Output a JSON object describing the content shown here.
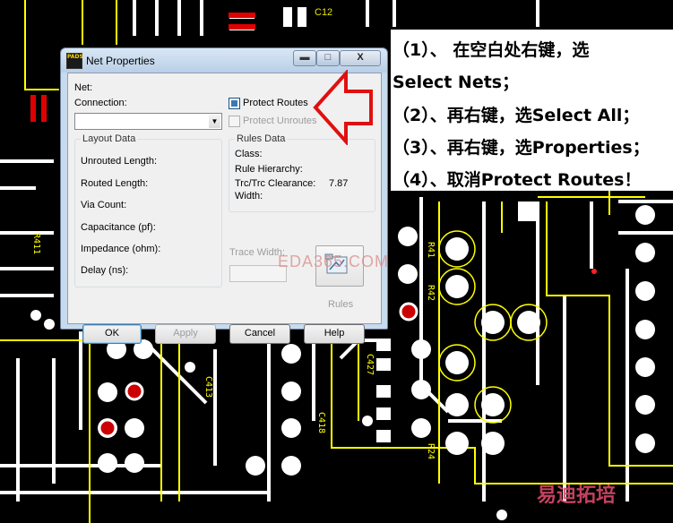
{
  "dialog": {
    "title": "Net Properties",
    "app_badge": "PADS",
    "net_label": "Net:",
    "connection_label": "Connection:",
    "connection_value": "",
    "protect_routes_label": "Protect Routes",
    "protect_routes_checked": true,
    "protect_unroutes_label": "Protect Unroutes",
    "protect_unroutes_checked": false,
    "layout_data": {
      "title": "Layout Data",
      "fields": [
        "Unrouted Length:",
        "Routed Length:",
        "Via Count:",
        "Capacitance (pf):",
        "Impedance (ohm):",
        "Delay (ns):"
      ]
    },
    "rules_data": {
      "title": "Rules Data",
      "class_label": "Class:",
      "hierarchy_label": "Rule Hierarchy:",
      "clearance_label": "Trc/Trc Clearance:",
      "clearance_value": "7.87",
      "width_label": "Width:"
    },
    "trace_width_label": "Trace Width:",
    "trace_width_value": "",
    "rules_button_label": "Rules",
    "buttons": {
      "ok": "OK",
      "apply": "Apply",
      "cancel": "Cancel",
      "help": "Help"
    },
    "window_buttons": {
      "minimize": "▬",
      "maximize": "□",
      "close": "X"
    }
  },
  "instructions": [
    "（1）、 在空白处右键，选",
    "Select Nets；",
    "（2）、再右键，选Select All；",
    "（3）、再右键，选Properties；",
    "（4）、取消Protect Routes！"
  ],
  "pcb": {
    "component_label": "C12",
    "silk_labels": [
      "R411",
      "R41",
      "R42",
      "C427",
      "C413",
      "C418",
      "R24"
    ],
    "trace_color": "#ffff00",
    "pad_color": "#ffffff",
    "via_color": "#e00000"
  },
  "watermark": "EDA365.COM",
  "corner_watermark": "易迪拓培"
}
